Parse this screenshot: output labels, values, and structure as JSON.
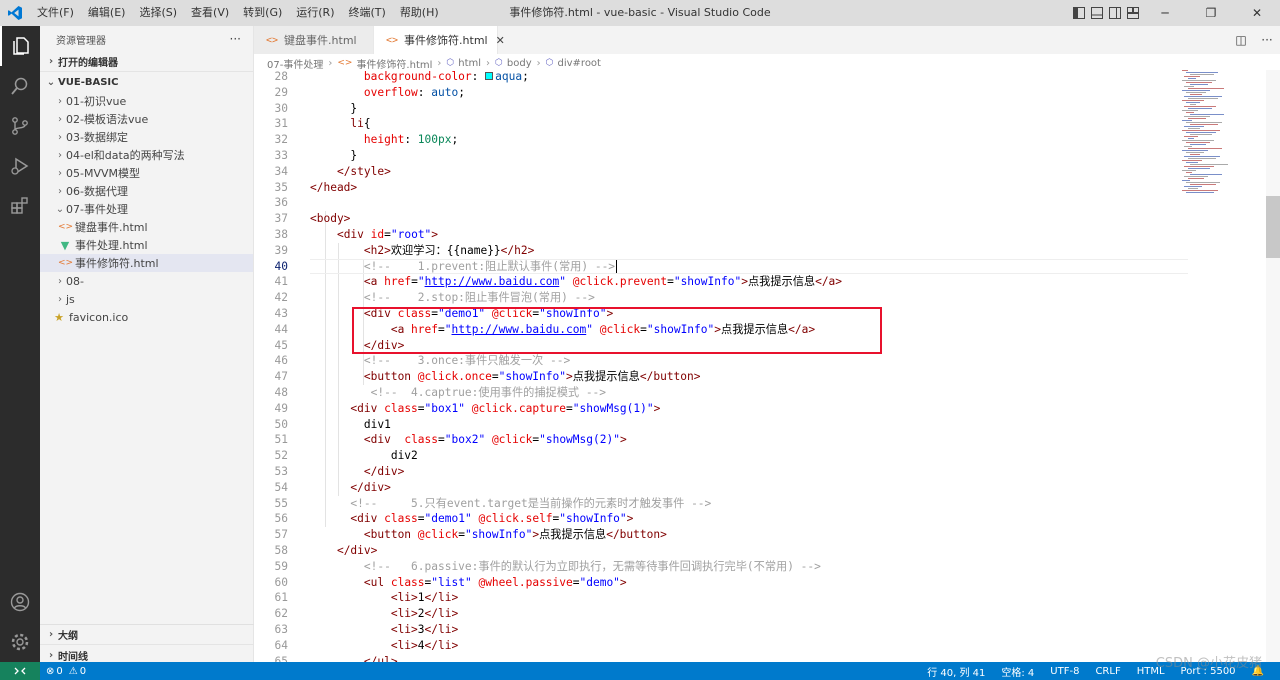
{
  "menu": [
    "文件(F)",
    "编辑(E)",
    "选择(S)",
    "查看(V)",
    "转到(G)",
    "运行(R)",
    "终端(T)",
    "帮助(H)"
  ],
  "window_title": "事件修饰符.html - vue-basic - Visual Studio Code",
  "sidebar": {
    "header": "资源管理器",
    "more": "···",
    "open_editors": "打开的编辑器",
    "root": "VUE-BASIC",
    "folders": [
      "01-初识vue",
      "02-模板语法vue",
      "03-数据绑定",
      "04-el和data的两种写法",
      "05-MVVM模型",
      "06-数据代理",
      "07-事件处理"
    ],
    "files_in_07": [
      "键盘事件.html",
      "事件处理.html",
      "事件修饰符.html"
    ],
    "after": [
      "08-",
      "js"
    ],
    "favicon": "favicon.ico",
    "outline": "大纲",
    "timeline": "时间线"
  },
  "tabs": [
    {
      "label": "键盘事件.html",
      "active": false
    },
    {
      "label": "事件修饰符.html",
      "active": true
    }
  ],
  "breadcrumbs": [
    "07-事件处理",
    "事件修饰符.html",
    "html",
    "body",
    "div#root"
  ],
  "status": {
    "errors": "0",
    "warnings": "0",
    "position": "行 40, 列 41",
    "spaces": "空格: 4",
    "encoding": "UTF-8",
    "eol": "CRLF",
    "lang": "HTML",
    "port": "Port : 5500"
  },
  "watermark": "CSDN @小花皮猪",
  "colors": {
    "accent": "#007acc",
    "highlight_box": "#e8112d",
    "activity_bar": "#2c2c2c"
  },
  "code_lines": [
    {
      "n": "28"
    },
    {
      "n": "29"
    },
    {
      "n": "30"
    },
    {
      "n": "31"
    },
    {
      "n": "32"
    },
    {
      "n": "33"
    },
    {
      "n": "34"
    },
    {
      "n": "35"
    },
    {
      "n": "36"
    },
    {
      "n": "37"
    },
    {
      "n": "38"
    },
    {
      "n": "39"
    },
    {
      "n": "40"
    },
    {
      "n": "41"
    },
    {
      "n": "42"
    },
    {
      "n": "43"
    },
    {
      "n": "44"
    },
    {
      "n": "45"
    },
    {
      "n": "46"
    },
    {
      "n": "47"
    },
    {
      "n": "48"
    },
    {
      "n": "49"
    },
    {
      "n": "50"
    },
    {
      "n": "51"
    },
    {
      "n": "52"
    },
    {
      "n": "53"
    },
    {
      "n": "54"
    },
    {
      "n": "55"
    },
    {
      "n": "56"
    },
    {
      "n": "57"
    },
    {
      "n": "58"
    },
    {
      "n": "59"
    },
    {
      "n": "60"
    },
    {
      "n": "61"
    },
    {
      "n": "62"
    },
    {
      "n": "63"
    },
    {
      "n": "64"
    },
    {
      "n": "65"
    }
  ]
}
